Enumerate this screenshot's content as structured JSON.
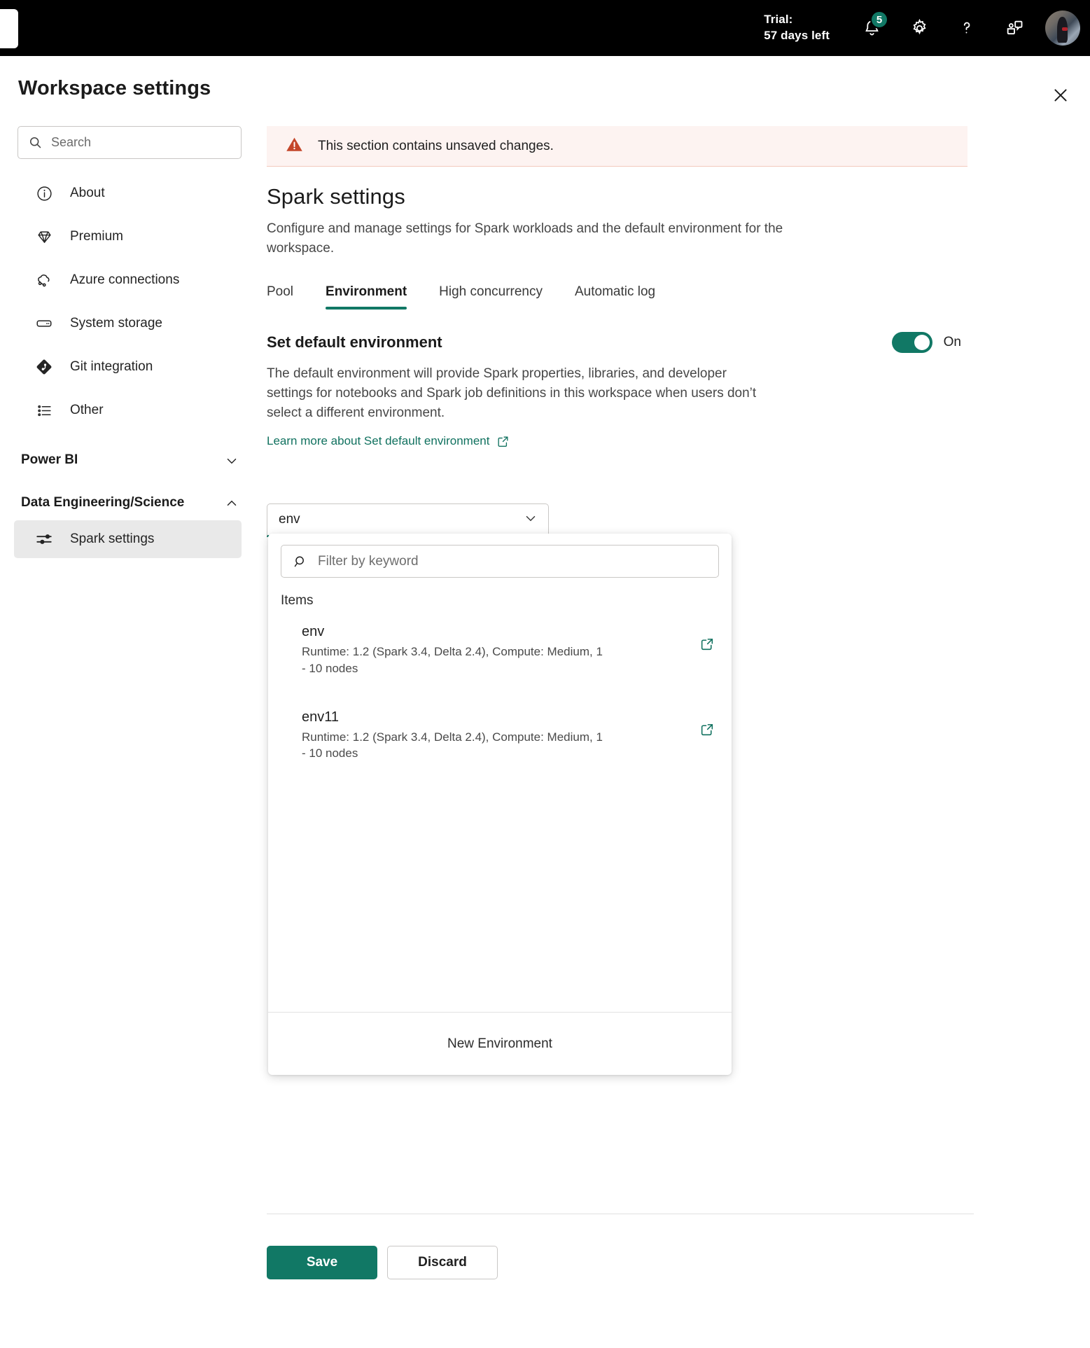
{
  "topbar": {
    "trial_line1": "Trial:",
    "trial_line2": "57 days left",
    "notifications_badge": "5",
    "icons": {
      "notifications": "bell-icon",
      "settings": "gear-icon",
      "help": "question-mark-icon",
      "feedback": "feedback-chat-icon",
      "avatar": "user-avatar"
    }
  },
  "header": {
    "title": "Workspace settings",
    "close_label": "Close"
  },
  "search": {
    "placeholder": "Search",
    "value": ""
  },
  "sidebar": {
    "items": [
      {
        "label": "About",
        "icon": "info-circle-icon"
      },
      {
        "label": "Premium",
        "icon": "diamond-icon"
      },
      {
        "label": "Azure connections",
        "icon": "cloud-link-icon"
      },
      {
        "label": "System storage",
        "icon": "storage-icon"
      },
      {
        "label": "Git integration",
        "icon": "git-icon"
      },
      {
        "label": "Other",
        "icon": "list-icon"
      }
    ],
    "groups": [
      {
        "label": "Power BI",
        "expanded": false,
        "chevron": "chevron-down-icon",
        "children": []
      },
      {
        "label": "Data Engineering/Science",
        "expanded": true,
        "chevron": "chevron-up-icon",
        "children": [
          {
            "label": "Spark settings",
            "icon": "sliders-icon",
            "selected": true
          }
        ]
      }
    ]
  },
  "main": {
    "banner": {
      "text": "This section contains unsaved changes.",
      "icon": "warning-triangle-icon",
      "bg_color": "#fdf3f1",
      "icon_color": "#c4462a"
    },
    "section_title": "Spark settings",
    "section_desc": "Configure and manage settings for Spark workloads and the default environment for the workspace.",
    "tabs": [
      {
        "label": "Pool",
        "active": false
      },
      {
        "label": "Environment",
        "active": true
      },
      {
        "label": "High concurrency",
        "active": false
      },
      {
        "label": "Automatic log",
        "active": false
      }
    ],
    "setting": {
      "title": "Set default environment",
      "toggle_state": "On",
      "toggle_on": true,
      "description": "The default environment will provide Spark properties, libraries, and developer settings for notebooks and Spark job definitions in this workspace when users don’t select a different environment.",
      "learn_more": "Learn more about Set default environment",
      "learn_more_icon": "external-link-icon"
    },
    "combobox": {
      "value": "env",
      "chevron": "chevron-down-icon"
    },
    "dropdown": {
      "filter_placeholder": "Filter by keyword",
      "filter_value": "",
      "filter_icon": "search-icon",
      "group_label": "Items",
      "items": [
        {
          "name": "env",
          "meta": "Runtime: 1.2 (Spark 3.4, Delta 2.4), Compute: Medium, 1 - 10 nodes",
          "open_icon": "open-in-new-window-icon"
        },
        {
          "name": "env11",
          "meta": "Runtime: 1.2 (Spark 3.4, Delta 2.4), Compute: Medium, 1 - 10 nodes",
          "open_icon": "open-in-new-window-icon"
        }
      ],
      "footer_label": "New Environment"
    }
  },
  "footer": {
    "save_label": "Save",
    "discard_label": "Discard"
  },
  "colors": {
    "accent_teal": "#117865",
    "link_teal": "#10715f",
    "warning_red": "#c4462a",
    "banner_bg": "#fdf3f1",
    "selected_bg": "#e9e9e9"
  }
}
